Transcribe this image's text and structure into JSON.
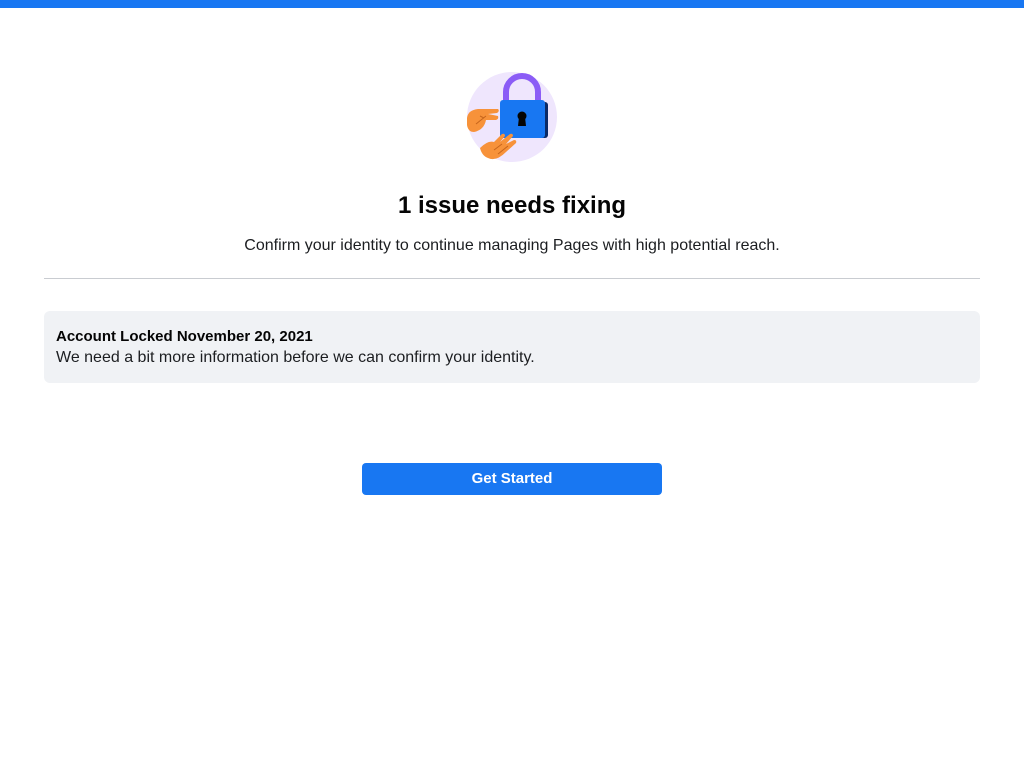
{
  "header": {
    "accent_color": "#1877f2"
  },
  "hero": {
    "icon": "padlock-with-hands-icon",
    "circle_color": "#efe6fd",
    "lock_color": "#1877f2",
    "shackle_color": "#8b5cf6",
    "hand_color": "#f7923a"
  },
  "main": {
    "title": "1 issue needs fixing",
    "subtitle": "Confirm your identity to continue managing Pages with high potential reach."
  },
  "notice": {
    "title": "Account Locked November 20, 2021",
    "body": "We need a bit more information before we can confirm your identity."
  },
  "actions": {
    "get_started_label": "Get Started"
  }
}
